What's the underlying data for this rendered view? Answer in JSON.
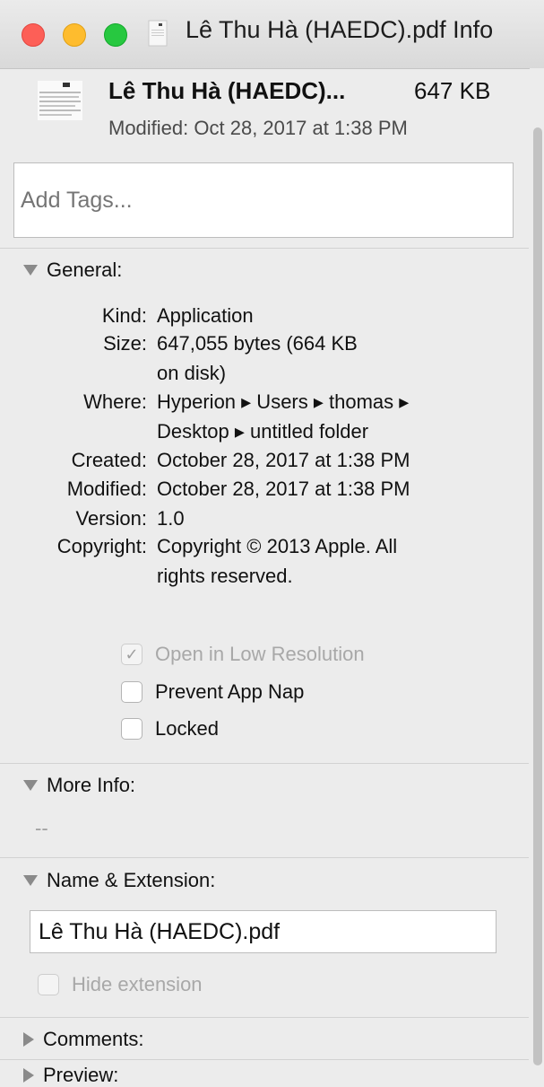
{
  "window": {
    "title": "Lê Thu Hà (HAEDC).pdf Info"
  },
  "header": {
    "file_name": "Lê Thu Hà (HAEDC)...",
    "file_size": "647 KB",
    "modified": "Modified: Oct 28, 2017 at 1:38 PM"
  },
  "tags": {
    "placeholder": "Add Tags..."
  },
  "general": {
    "label": "General:",
    "rows": [
      {
        "key": "Kind:",
        "value": "Application"
      },
      {
        "key": "Size:",
        "value": "647,055 bytes (664 KB",
        "value2": "on disk)"
      },
      {
        "key": "Where:",
        "value": "Hyperion ▸ Users ▸ thomas ▸",
        "value2": "Desktop ▸ untitled folder"
      },
      {
        "key": "Created:",
        "value": "October 28, 2017 at 1:38 PM"
      },
      {
        "key": "Modified:",
        "value": "October 28, 2017 at 1:38 PM"
      },
      {
        "key": "Version:",
        "value": "1.0"
      },
      {
        "key": "Copyright:",
        "value": "Copyright © 2013 Apple. All",
        "value2": "rights reserved."
      }
    ],
    "checkboxes": [
      {
        "label": "Open in Low Resolution",
        "checked": true,
        "disabled": true
      },
      {
        "label": "Prevent App Nap",
        "checked": false,
        "disabled": false
      },
      {
        "label": "Locked",
        "checked": false,
        "disabled": false
      }
    ]
  },
  "more_info": {
    "label": "More Info:",
    "value": "--"
  },
  "name_ext": {
    "label": "Name & Extension:",
    "value": "Lê Thu Hà (HAEDC).pdf",
    "hide_extension_label": "Hide extension"
  },
  "comments": {
    "label": "Comments:"
  },
  "preview": {
    "label": "Preview:"
  },
  "icons": {
    "checkmark": "✓"
  }
}
